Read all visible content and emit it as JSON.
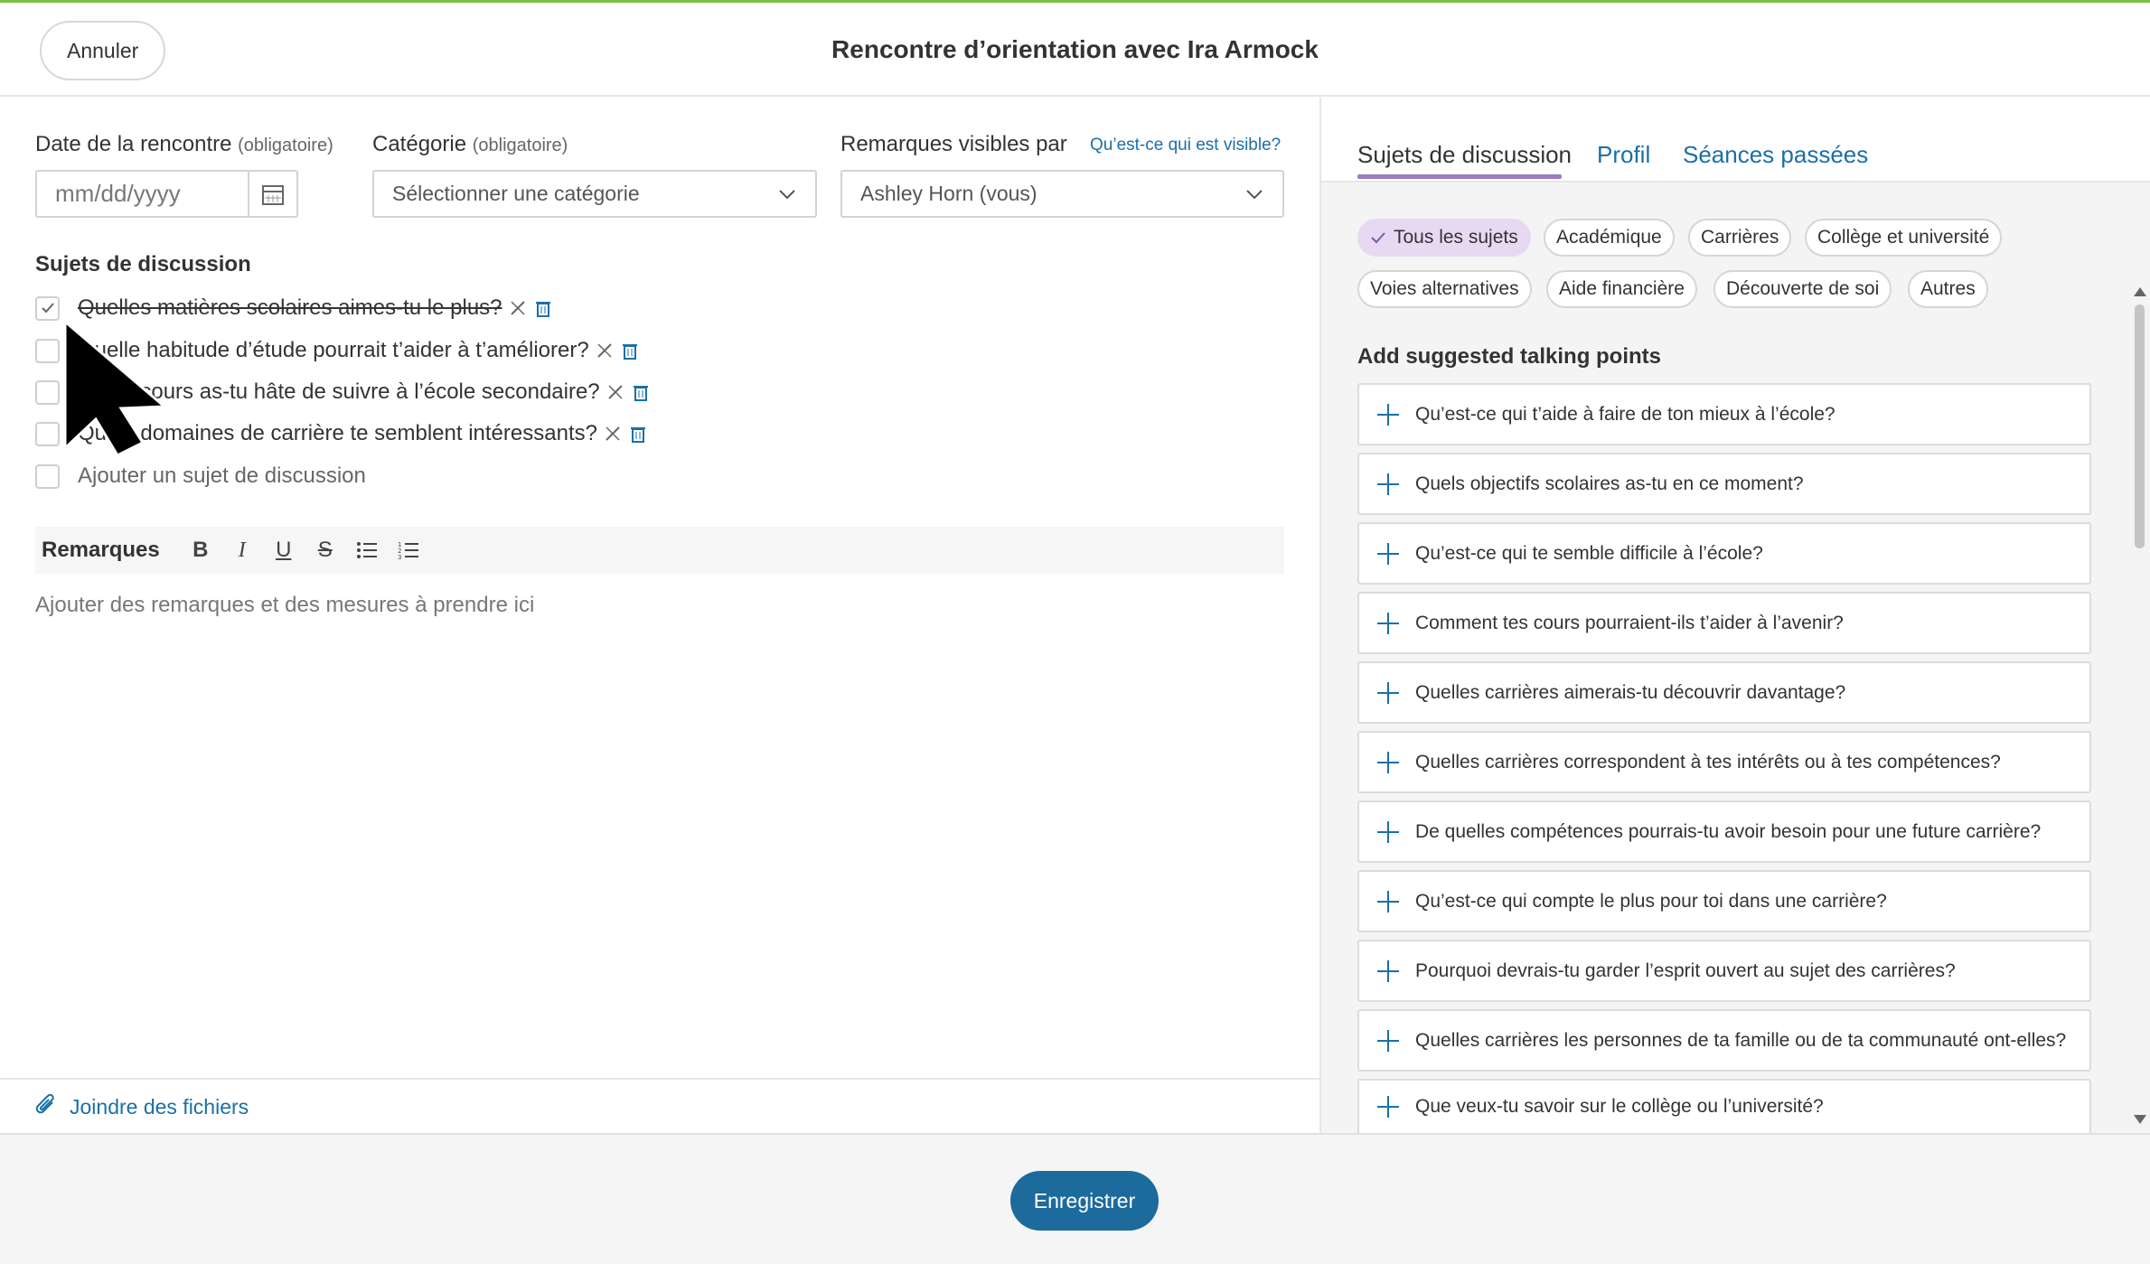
{
  "header": {
    "cancel_label": "Annuler",
    "title": "Rencontre d’orientation avec Ira Armock"
  },
  "form": {
    "date_label": "Date de la rencontre",
    "date_required": "(obligatoire)",
    "date_placeholder": "mm/dd/yyyy",
    "category_label": "Catégorie",
    "category_required": "(obligatoire)",
    "category_value": "Sélectionner une catégorie",
    "visibility_label": "Remarques visibles par",
    "visibility_link": "Qu’est-ce qui est visible?",
    "visibility_value": "Ashley Horn (vous)"
  },
  "topics": {
    "title": "Sujets de discussion",
    "items": [
      {
        "text": "Quelles matières scolaires aimes-tu le plus?",
        "checked": true
      },
      {
        "text": "Quelle habitude d’étude pourrait t’aider à t’améliorer?",
        "checked": false
      },
      {
        "text": "Quels cours as-tu hâte de suivre à l’école secondaire?",
        "checked": false
      },
      {
        "text": "Quels domaines de carrière te semblent intéressants?",
        "checked": false
      }
    ],
    "add_placeholder": "Ajouter un sujet de discussion"
  },
  "notes": {
    "label": "Remarques",
    "placeholder": "Ajouter des remarques et des mesures à prendre ici"
  },
  "attach_label": "Joindre des fichiers",
  "tabs": [
    "Sujets de discussion",
    "Profil",
    "Séances passées"
  ],
  "chips": [
    "Tous les sujets",
    "Académique",
    "Carrières",
    "Collège et université",
    "Voies alternatives",
    "Aide financière",
    "Découverte de soi",
    "Autres"
  ],
  "suggestions": {
    "title": "Add suggested talking points",
    "items": [
      "Qu’est-ce qui t’aide à faire de ton mieux à l’école?",
      "Quels objectifs scolaires as-tu en ce moment?",
      "Qu’est-ce qui te semble difficile à l’école?",
      "Comment tes cours pourraient-ils t’aider à l’avenir?",
      "Quelles carrières aimerais-tu découvrir davantage?",
      "Quelles carrières correspondent à tes intérêts ou à tes compétences?",
      "De quelles compétences pourrais-tu avoir besoin pour une future carrière?",
      "Qu’est-ce qui compte le plus pour toi dans une carrière?",
      "Pourquoi devrais-tu garder l’esprit ouvert au sujet des carrières?",
      "Quelles carrières les personnes de ta famille ou de ta communauté ont-elles?",
      "Que veux-tu savoir sur le collège ou l’université?"
    ]
  },
  "footer": {
    "save_label": "Enregistrer"
  },
  "colors": {
    "accent": "#1c6b9c",
    "link": "#1b6fa8",
    "tab_underline": "#9b7bc4",
    "chip_active": "#e8d9f3",
    "top_line": "#7ac142"
  }
}
